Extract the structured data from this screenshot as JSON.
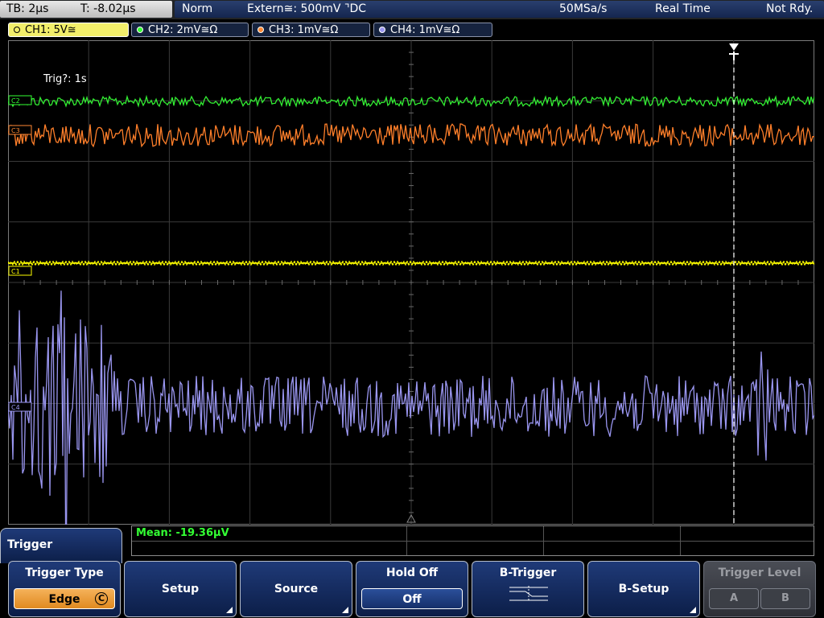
{
  "topbar": {
    "timebase": "TB: 2µs",
    "trigger_time": "T: -8.02µs",
    "mode": "Norm",
    "trigger_source": "Extern≅: 500mV ⌝DC",
    "sample_rate": "50MSa/s",
    "acquisition": "Real Time",
    "status": "Not Rdy."
  },
  "channels": [
    {
      "label": "CH1: 5V≅",
      "color": "#ffff00"
    },
    {
      "label": "CH2: 2mV≅Ω",
      "color": "#33ff33"
    },
    {
      "label": "CH3: 1mV≅Ω",
      "color": "#ff8833"
    },
    {
      "label": "CH4: 1mV≅Ω",
      "color": "#9a96f0"
    }
  ],
  "screen": {
    "trig_status": "Trig?: 1s",
    "markers": {
      "ch1": "C1",
      "ch2": "C2",
      "ch3": "C3",
      "ch4": "C4"
    }
  },
  "measurement": {
    "mean": "Mean: -19.36µV"
  },
  "menu": {
    "title": "Trigger",
    "softkeys": {
      "trigger_type": {
        "label": "Trigger Type",
        "value": "Edge",
        "badge": "C"
      },
      "setup": "Setup",
      "source": "Source",
      "hold_off": {
        "label": "Hold Off",
        "value": "Off"
      },
      "b_trigger": "B-Trigger",
      "b_setup": "B-Setup",
      "trigger_level": {
        "label": "Trigger Level",
        "a": "A",
        "b": "B"
      }
    }
  }
}
